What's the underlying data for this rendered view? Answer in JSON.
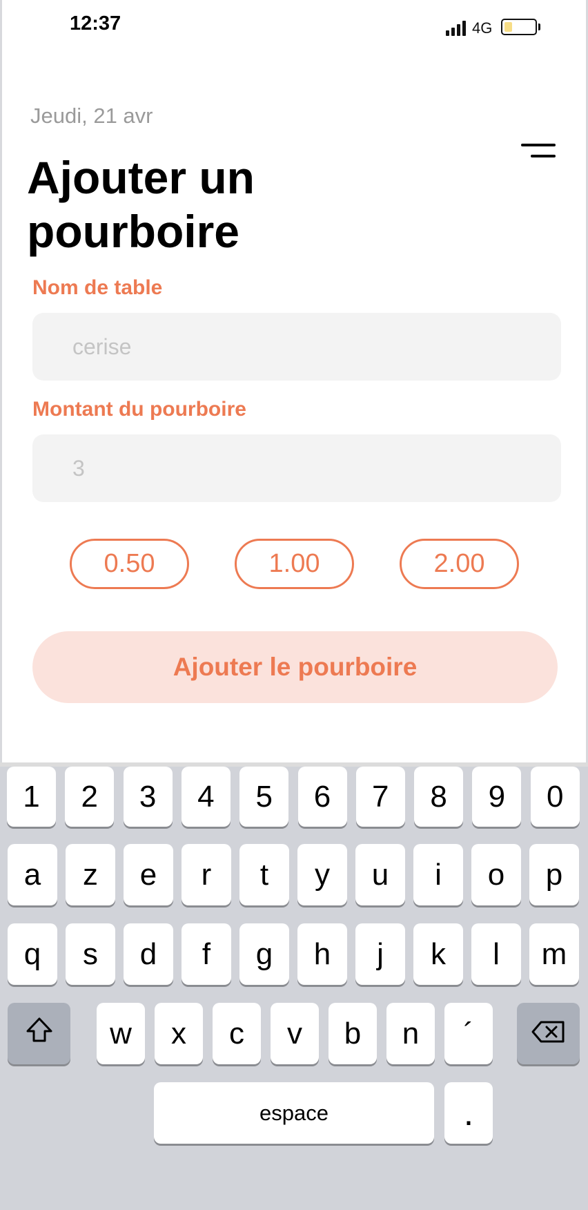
{
  "status_bar": {
    "time": "12:37",
    "network": "4G",
    "battery_level": 0.25,
    "battery_color": "#f7dd86"
  },
  "header": {
    "date": "Jeudi, 21 avr",
    "title": "Ajouter un pourboire",
    "menu_icon": "hamburger-menu-icon"
  },
  "form": {
    "table_label": "Nom de table",
    "table_placeholder": "cerise",
    "table_value": "",
    "amount_label": "Montant du pourboire",
    "amount_placeholder": "3",
    "amount_value": ""
  },
  "quick_amounts": [
    "0.50",
    "1.00",
    "2.00"
  ],
  "submit_label": "Ajouter le pourboire",
  "colors": {
    "accent": "#ed7a52",
    "button_bg": "#fbe2dc",
    "field_bg": "#f3f3f3"
  },
  "keyboard": {
    "row_numbers": [
      "1",
      "2",
      "3",
      "4",
      "5",
      "6",
      "7",
      "8",
      "9",
      "0"
    ],
    "row1": [
      "a",
      "z",
      "e",
      "r",
      "t",
      "y",
      "u",
      "i",
      "o",
      "p"
    ],
    "row2": [
      "q",
      "s",
      "d",
      "f",
      "g",
      "h",
      "j",
      "k",
      "l",
      "m"
    ],
    "row3": [
      "w",
      "x",
      "c",
      "v",
      "b",
      "n",
      "´"
    ],
    "shift_icon": "shift-arrow-icon",
    "delete_icon": "backspace-icon",
    "space_label": "espace",
    "period_label": "."
  }
}
